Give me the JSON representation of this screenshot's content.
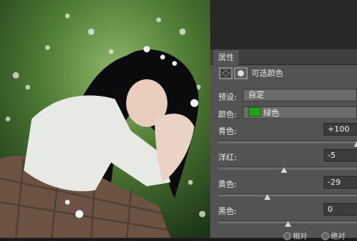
{
  "panel": {
    "tab_label": "属性",
    "title": "可选颜色",
    "preset_label": "预设:",
    "preset_value": "自定",
    "color_label": "颜色:",
    "color_value": "绿色",
    "color_swatch": "#1fa317"
  },
  "sliders": [
    {
      "label": "青色:",
      "value": "+100",
      "level": 100
    },
    {
      "label": "洋红:",
      "value": "-5",
      "level": -5
    },
    {
      "label": "黄色:",
      "value": "-29",
      "level": -29
    },
    {
      "label": "黑色:",
      "value": "0",
      "level": 0
    }
  ],
  "method": {
    "relative_label": "相对",
    "absolute_label": "绝对"
  },
  "icons": {
    "adjustment_icon": "layer-mask-thumbnail-icon",
    "mask_icon": "mask-circle-icon"
  }
}
